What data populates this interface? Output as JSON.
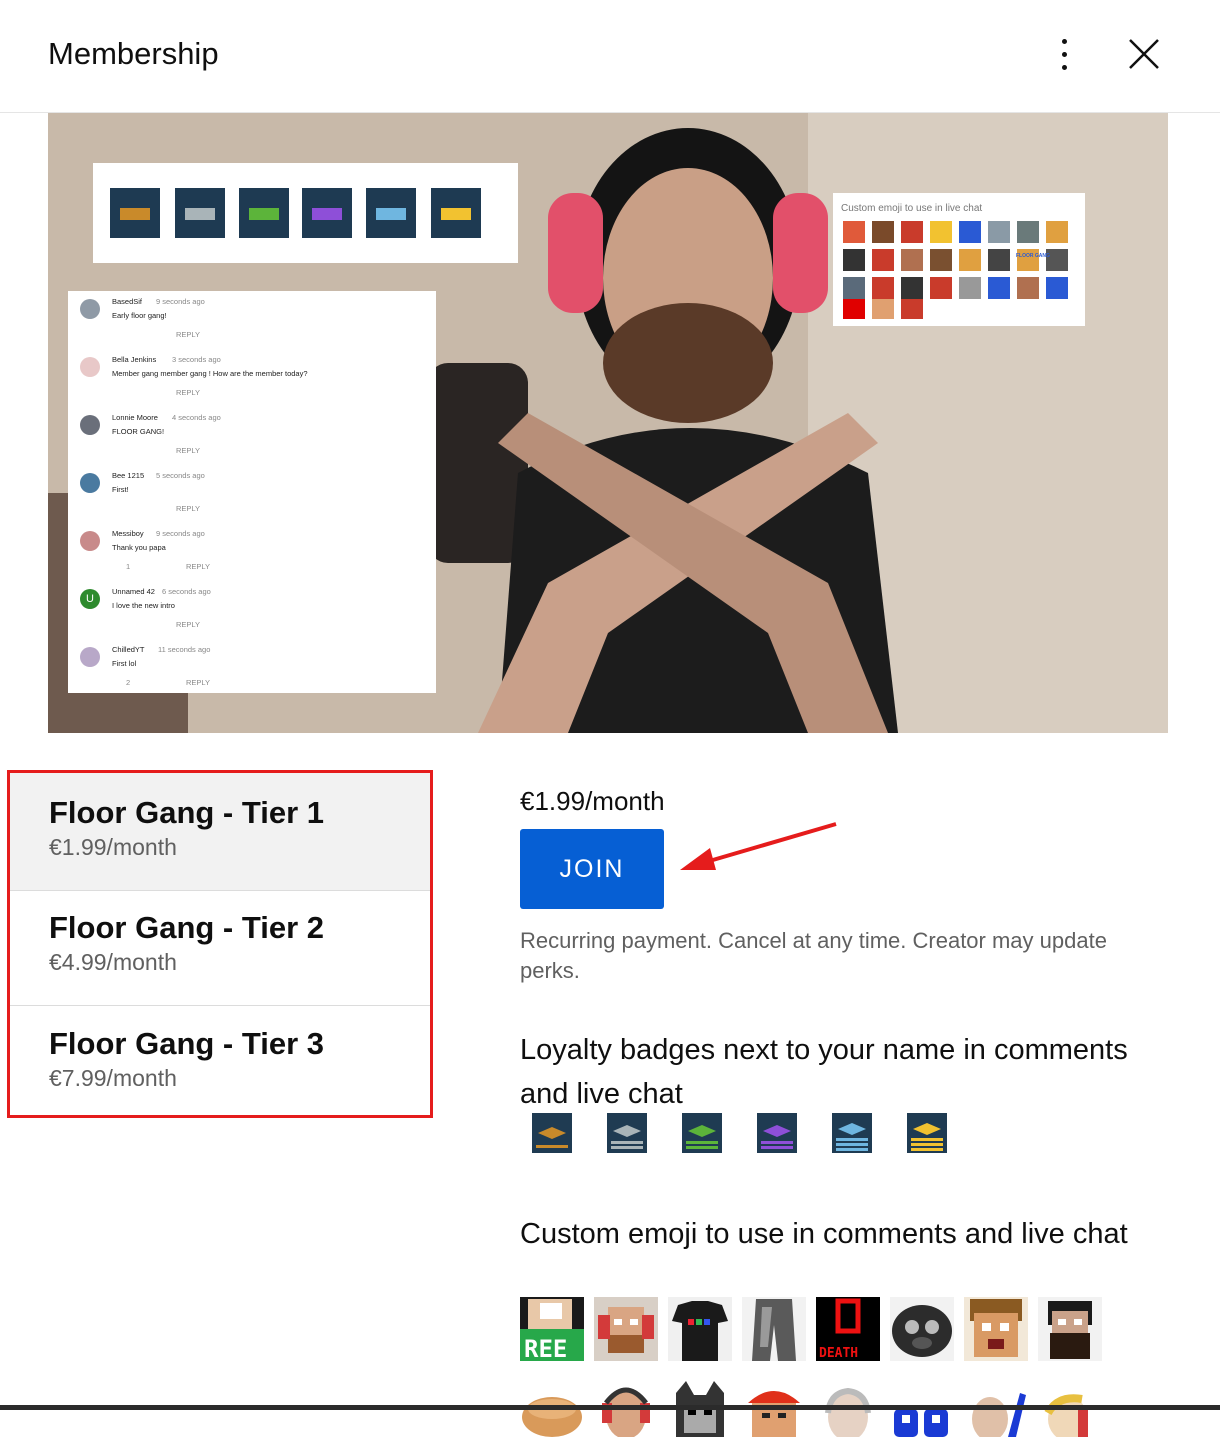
{
  "dialog": {
    "title": "Membership"
  },
  "header": {
    "more_icon": "more-vert-icon",
    "close_icon": "close-icon"
  },
  "tiers": [
    {
      "name": "Floor Gang - Tier 1",
      "price": "€1.99/month",
      "selected": true
    },
    {
      "name": "Floor Gang - Tier 2",
      "price": "€4.99/month",
      "selected": false
    },
    {
      "name": "Floor Gang - Tier 3",
      "price": "€7.99/month",
      "selected": false
    }
  ],
  "details": {
    "price": "€1.99/month",
    "join_label": "JOIN",
    "recurring_note": "Recurring payment. Cancel at any time. Creator may update perks.",
    "loyalty_title": "Loyalty badges next to your name in comments and live chat",
    "emoji_title": "Custom emoji to use in comments and live chat"
  },
  "hero": {
    "emoji_panel_title": "Custom emoji to use in live chat",
    "emoji_panel_floor_gang": "FLOOR GANG",
    "comment_reply_label": "REPLY",
    "comments": [
      {
        "author": "BasedSif",
        "time": "9 seconds ago",
        "text": "Early floor gang!",
        "likes": ""
      },
      {
        "author": "Bella Jenkins",
        "time": "3 seconds ago",
        "text": "Member gang member gang ! How are the member today?",
        "likes": ""
      },
      {
        "author": "Lonnie Moore",
        "time": "4 seconds ago",
        "text": "FLOOR GANG!",
        "likes": ""
      },
      {
        "author": "Bee 1215",
        "time": "5 seconds ago",
        "text": "First!",
        "likes": ""
      },
      {
        "author": "Messiboy",
        "time": "9 seconds ago",
        "text": "Thank you papa",
        "likes": "1"
      },
      {
        "author": "Unnamed 42",
        "time": "6 seconds ago",
        "text": "I love the new intro",
        "likes": ""
      },
      {
        "author": "ChilledYT",
        "time": "11 seconds ago",
        "text": "First lol",
        "likes": "2"
      }
    ]
  },
  "colors": {
    "join_button": "#065fd4",
    "annotation_red": "#e51c1c",
    "selected_tier_bg": "#f2f2f2",
    "secondary_text": "#606060",
    "badge_bronze": "#c98a2a",
    "badge_silver": "#a9b4b8",
    "badge_green": "#5cb43a",
    "badge_purple": "#8e4fd8",
    "badge_blue": "#6fb6e0",
    "badge_gold": "#f2c230"
  },
  "badges": [
    "bronze-badge-icon",
    "silver-badge-icon",
    "green-badge-icon",
    "purple-badge-icon",
    "blue-badge-icon",
    "gold-badge-icon"
  ],
  "emojis": [
    {
      "icon": "ree-emoji-icon",
      "text": "REE"
    },
    {
      "icon": "pewds-headphones-emoji-icon",
      "text": ""
    },
    {
      "icon": "tshirt-emoji-icon",
      "text": ""
    },
    {
      "icon": "pants-emoji-icon",
      "text": ""
    },
    {
      "icon": "death-emoji-icon",
      "text": "DEATH"
    },
    {
      "icon": "pug-emoji-icon",
      "text": ""
    },
    {
      "icon": "shocked-face-emoji-icon",
      "text": ""
    },
    {
      "icon": "beard-face-emoji-icon",
      "text": ""
    },
    {
      "icon": "bread-emoji-icon",
      "text": ""
    },
    {
      "icon": "headset-emoji-icon",
      "text": ""
    },
    {
      "icon": "cat-emoji-icon",
      "text": ""
    },
    {
      "icon": "bandana-emoji-icon",
      "text": ""
    },
    {
      "icon": "old-man-emoji-icon",
      "text": ""
    },
    {
      "icon": "pp-emoji-icon",
      "text": ""
    },
    {
      "icon": "pointing-emoji-icon",
      "text": ""
    },
    {
      "icon": "mic-emoji-icon",
      "text": ""
    }
  ]
}
